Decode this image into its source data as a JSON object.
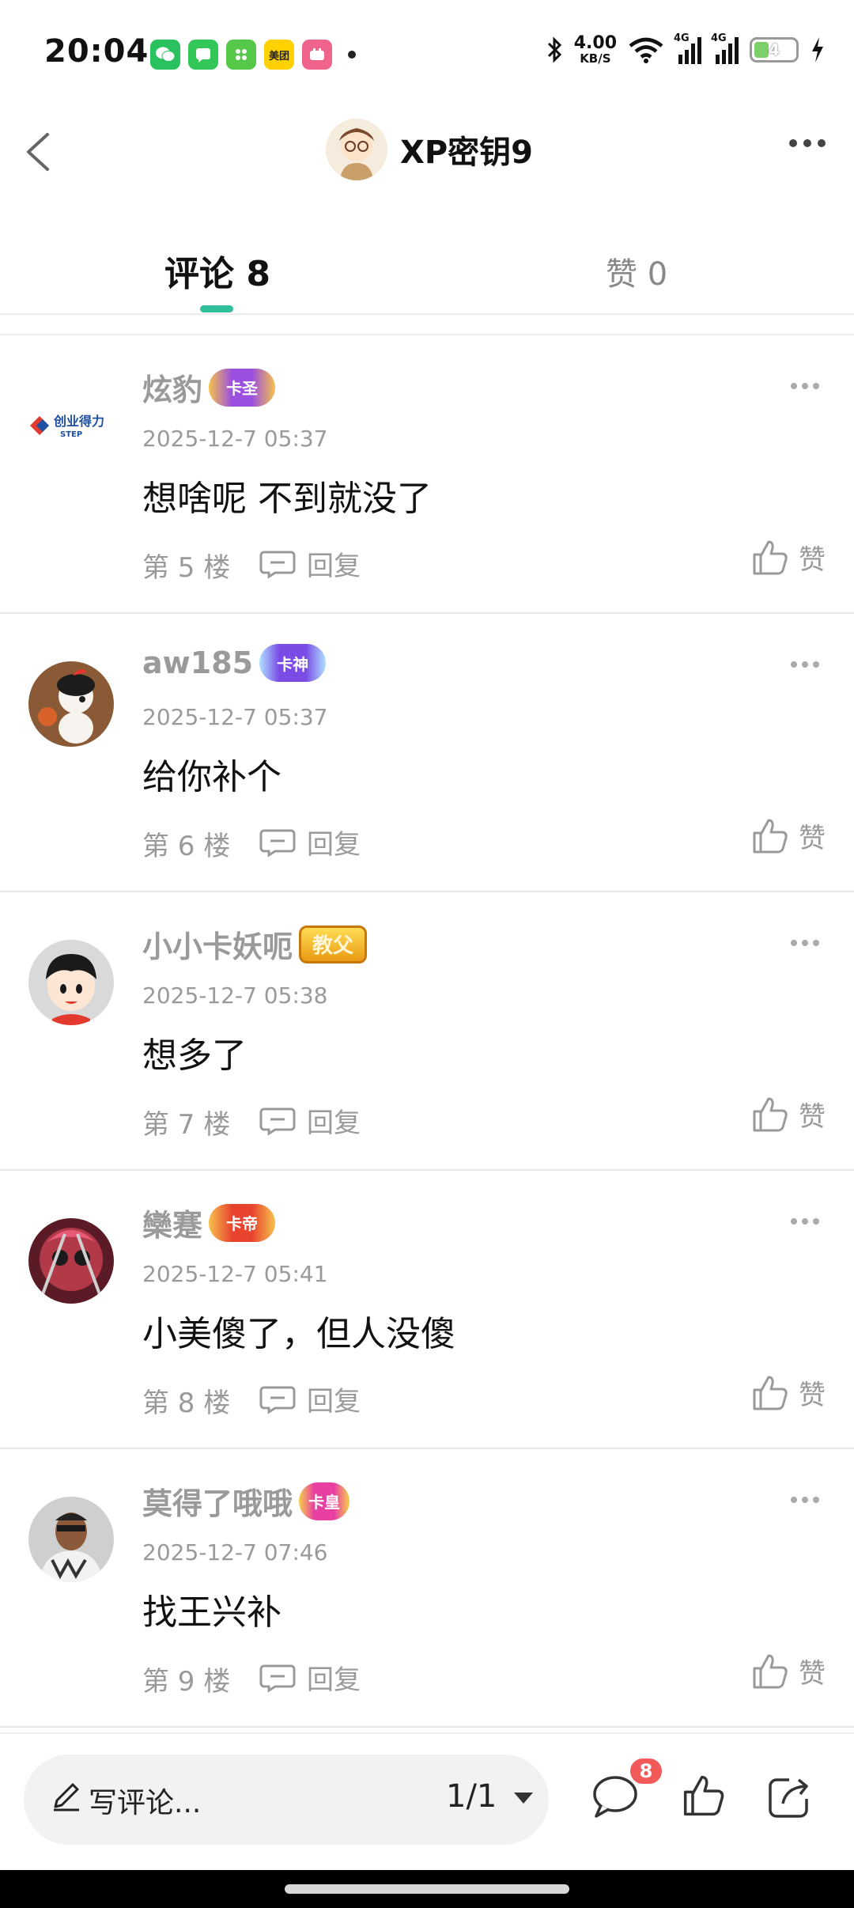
{
  "status_bar": {
    "time": "20:04",
    "apps": [
      {
        "name": "wechat-icon",
        "color": "#2ac25e",
        "label": ""
      },
      {
        "name": "messages-icon",
        "color": "#33c75a",
        "label": ""
      },
      {
        "name": "app-green-icon",
        "color": "#55c84a",
        "label": ""
      },
      {
        "name": "meituan-icon",
        "color": "#ffd100",
        "label": "美团"
      },
      {
        "name": "app-pink-icon",
        "color": "#f0638b",
        "label": ""
      }
    ],
    "net_speed_value": "4.00",
    "net_speed_unit": "KB/S",
    "signal1_label": "4G",
    "signal2_label": "4G",
    "battery": "4"
  },
  "header": {
    "title": "XP密钥9"
  },
  "tabs": {
    "comments_label": "评论 8",
    "likes_label": "赞 0"
  },
  "comments": [
    {
      "name": "炫豹",
      "badge": "卡圣",
      "time": "2025-12-7 05:37",
      "text": "想啥呢  不到就没了",
      "floor": "第 5 楼",
      "reply": "回复",
      "like": "赞"
    },
    {
      "name": "aw185",
      "badge": "卡神",
      "time": "2025-12-7 05:37",
      "text": "给你补个",
      "floor": "第 6 楼",
      "reply": "回复",
      "like": "赞"
    },
    {
      "name": "小小卡妖呃",
      "badge": "教父",
      "time": "2025-12-7 05:38",
      "text": "想多了",
      "floor": "第 7 楼",
      "reply": "回复",
      "like": "赞"
    },
    {
      "name": "欒蹇",
      "badge": "卡帝",
      "time": "2025-12-7 05:41",
      "text": "小美傻了，但人没傻",
      "floor": "第 8 楼",
      "reply": "回复",
      "like": "赞"
    },
    {
      "name": "莫得了哦哦",
      "badge": "卡皇",
      "time": "2025-12-7 07:46",
      "text": "找王兴补",
      "floor": "第 9 楼",
      "reply": "回复",
      "like": "赞"
    }
  ],
  "bottom_bar": {
    "input_placeholder": "写评论...",
    "page_indicator": "1/1",
    "comment_count": "8"
  },
  "colors": {
    "accent": "#2fbf9a",
    "muted_text": "#9a9a9a",
    "badge_red": "#f25a5a"
  }
}
